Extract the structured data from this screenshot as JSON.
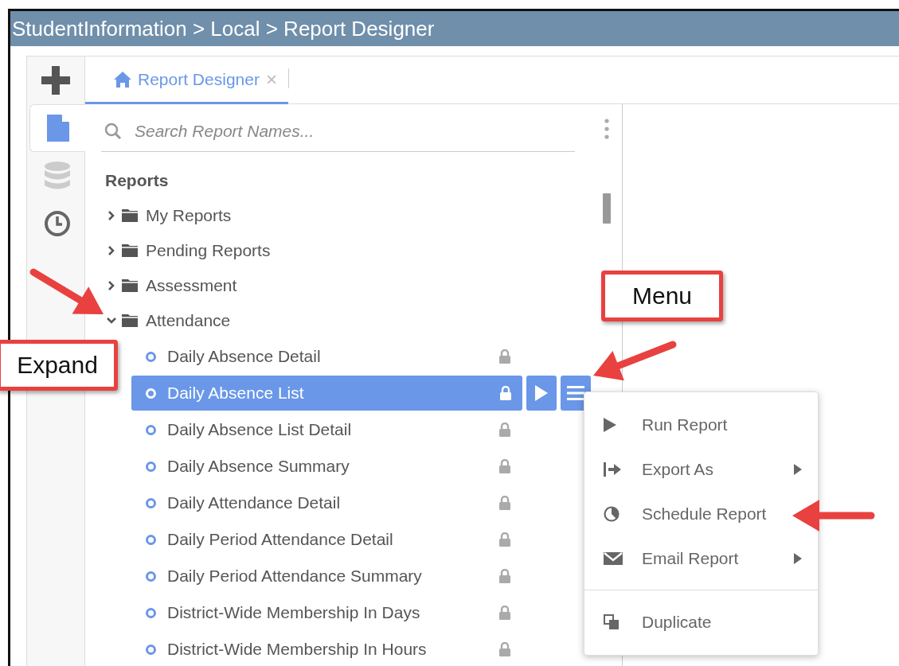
{
  "window": {
    "title": "StudentInformation > Local > Report Designer"
  },
  "rail": [
    {
      "kind": "reports",
      "selected": true
    },
    {
      "kind": "data",
      "selected": false
    },
    {
      "kind": "history",
      "selected": false
    }
  ],
  "tabs": [
    {
      "label": "Report Designer",
      "close": "×",
      "selected": true
    }
  ],
  "search": {
    "placeholder": "Search Report Names..."
  },
  "tree": {
    "heading": "Reports",
    "items": [
      {
        "label": "My Reports",
        "expanded": false
      },
      {
        "label": "Pending Reports",
        "expanded": false
      },
      {
        "label": "Assessment",
        "expanded": false
      },
      {
        "label": "Attendance",
        "expanded": true,
        "children": [
          {
            "label": "Daily Absence Detail",
            "selected": false
          },
          {
            "label": "Daily Absence List",
            "selected": true
          },
          {
            "label": "Daily Absence List Detail",
            "selected": false
          },
          {
            "label": "Daily Absence Summary",
            "selected": false
          },
          {
            "label": "Daily Attendance Detail",
            "selected": false
          },
          {
            "label": "Daily Period Attendance Detail",
            "selected": false
          },
          {
            "label": "Daily Period Attendance Summary",
            "selected": false
          },
          {
            "label": "District-Wide Membership In Days",
            "selected": false
          },
          {
            "label": "District-Wide Membership In Hours",
            "selected": false
          }
        ]
      }
    ]
  },
  "context_menu": {
    "items": [
      {
        "label": "Run Report",
        "kind": "run",
        "submenu": false,
        "divider_before": false
      },
      {
        "label": "Export As",
        "kind": "export",
        "submenu": true,
        "divider_before": false
      },
      {
        "label": "Schedule Report",
        "kind": "schedule",
        "submenu": false,
        "divider_before": false
      },
      {
        "label": "Email Report",
        "kind": "email",
        "submenu": true,
        "divider_before": false
      },
      {
        "label": "Duplicate",
        "kind": "duplicate",
        "submenu": false,
        "divider_before": true
      }
    ]
  },
  "annotations": [
    {
      "text": "Menu",
      "kind": "menu"
    },
    {
      "text": "Expand",
      "kind": "expand"
    }
  ]
}
